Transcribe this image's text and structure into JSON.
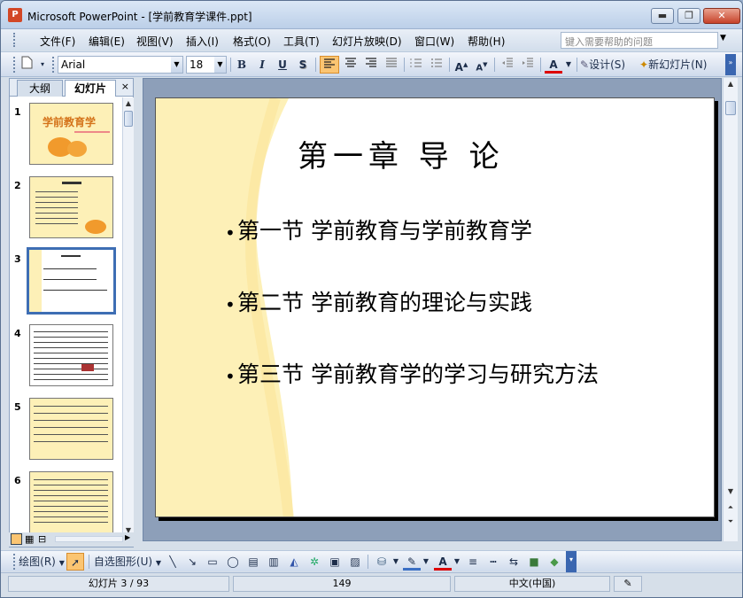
{
  "window": {
    "title": "Microsoft PowerPoint - [学前教育学课件.ppt]",
    "app_icon": "powerpoint-icon",
    "minimize": "▬",
    "restore": "❐",
    "close": "✕"
  },
  "menu": {
    "items": [
      "文件(F)",
      "编辑(E)",
      "视图(V)",
      "插入(I)",
      "格式(O)",
      "工具(T)",
      "幻灯片放映(D)",
      "窗口(W)",
      "帮助(H)"
    ],
    "help_placeholder": "键入需要帮助的问题"
  },
  "toolbar": {
    "font": "Arial",
    "size": "18",
    "bold": "B",
    "italic": "I",
    "underline": "U",
    "shadow": "S",
    "design": "设计(S)",
    "new_slide": "新幻灯片(N)"
  },
  "left_pane": {
    "tab_outline": "大纲",
    "tab_slides": "幻灯片",
    "close": "×",
    "thumb_nums": [
      "1",
      "2",
      "3",
      "4",
      "5",
      "6"
    ],
    "thumb1_title": "学前教育学"
  },
  "slide": {
    "title": "第一章 导 论",
    "bullets": [
      "第一节 学前教育与学前教育学",
      "第二节 学前教育的理论与实践",
      "第三节 学前教育学的学习与研究方法"
    ],
    "bullet_char": "•"
  },
  "drawbar": {
    "draw": "绘图(R)",
    "autoshapes": "自选图形(U)"
  },
  "status": {
    "slide": "幻灯片 3 / 93",
    "number": "149",
    "language": "中文(中国)"
  },
  "colors": {
    "title_bar": "#bccfe8",
    "accent": "#d24726",
    "slide_yellow": "#fdf0b7"
  }
}
